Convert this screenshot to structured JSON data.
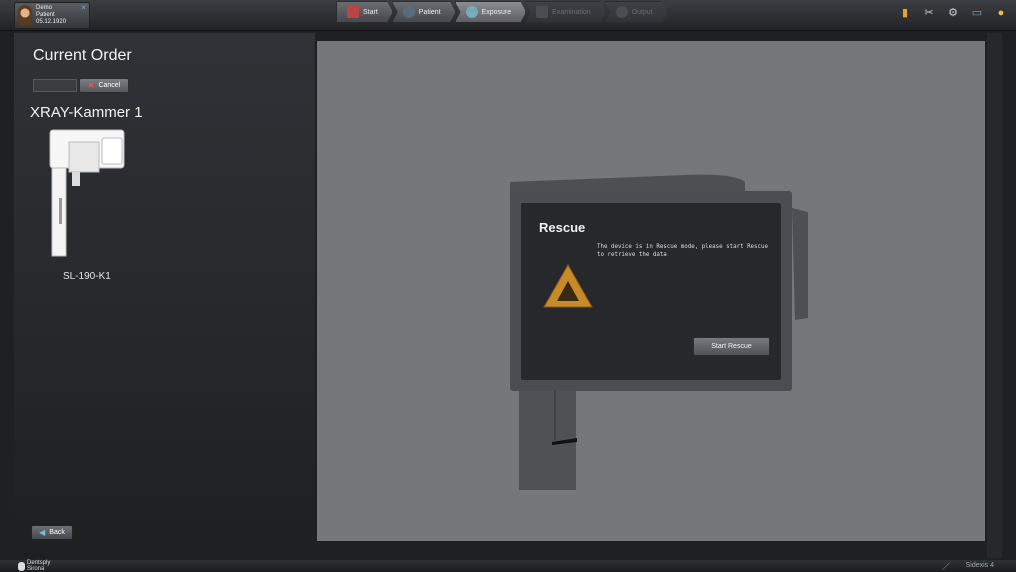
{
  "patient": {
    "name": "Demo",
    "type": "Patient",
    "dob": "05.12.1920",
    "avatar_icon": "patient-avatar-icon"
  },
  "workflow": {
    "steps": [
      {
        "label": "Start",
        "icon": "start-icon",
        "state": "normal"
      },
      {
        "label": "Patient",
        "icon": "patient-icon",
        "state": "normal"
      },
      {
        "label": "Exposure",
        "icon": "exposure-icon",
        "state": "active"
      },
      {
        "label": "Examination",
        "icon": "examination-icon",
        "state": "disabled"
      },
      {
        "label": "Output",
        "icon": "output-icon",
        "state": "disabled"
      }
    ]
  },
  "toolbar_icons": [
    "book-icon",
    "tools-icon",
    "settings-icon",
    "monitor-icon",
    "help-icon"
  ],
  "left": {
    "title": "Current Order",
    "cancel_label": "Cancel",
    "device_name": "XRAY-Kammer 1",
    "device_model": "SL-190-K1",
    "back_label": "Back"
  },
  "dialog": {
    "title": "Rescue",
    "message": "The device is in Rescue mode, please start Rescue to retrieve the data",
    "button": "Start Rescue"
  },
  "footer": {
    "brand_line1": "Dentsply",
    "brand_line2": "Sirona",
    "product": "Sidexis 4"
  },
  "colors": {
    "panel": "#74787b",
    "background": "#1e2022",
    "warning": "#c98a2a"
  }
}
